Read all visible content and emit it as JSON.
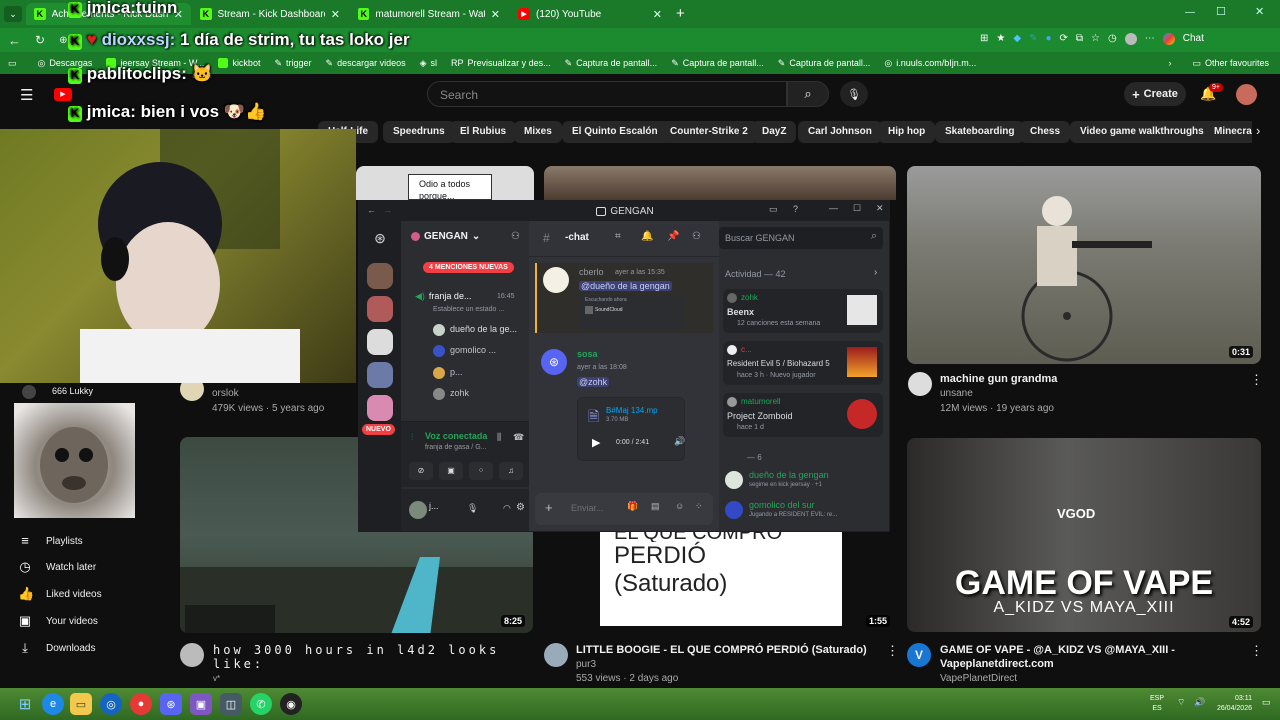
{
  "browser": {
    "tabs": [
      {
        "label": "Achievements - Kick Dashboard",
        "fav": "K"
      },
      {
        "label": "Stream - Kick Dashboard",
        "fav": "K"
      },
      {
        "label": "matumorell Stream - Watch Live o",
        "fav": "K"
      },
      {
        "label": "(120) YouTube",
        "fav": "▶"
      }
    ],
    "extension_label": "Chat",
    "bookmarks": [
      "Descargas",
      "jeersay Stream - W...",
      "kickbot",
      "trigger",
      "descargar videos",
      "sl",
      "Previsualizar y des...",
      "Captura de pantall...",
      "Captura de pantall...",
      "Captura de pantall...",
      "i.nuuls.com/bIjn.m..."
    ],
    "other_bookmarks": "Other favourites"
  },
  "overlay_chat": [
    {
      "user": "jmica:",
      "text": "tuinn"
    },
    {
      "user": "dioxxssj:",
      "text": "1 día de strim, tu tas loko jer"
    },
    {
      "user": "pablitoclips:",
      "text": ""
    },
    {
      "user": "jmica:",
      "text": "bien i vos"
    }
  ],
  "youtube": {
    "search_placeholder": "Search",
    "create_label": "Create",
    "notif_count": "9+",
    "chips": [
      "Half-Life",
      "Speedruns",
      "El Rubius",
      "Mixes",
      "El Quinto Escalón",
      "Counter-Strike 2",
      "DayZ",
      "Carl Johnson",
      "Hip hop",
      "Skateboarding",
      "Chess",
      "Video game walkthroughs",
      "Minecra"
    ],
    "sidebar": [
      {
        "label": "Playlists",
        "icon": "playlist-icon"
      },
      {
        "label": "Watch later",
        "icon": "clock-icon"
      },
      {
        "label": "Liked videos",
        "icon": "thumbs-up-icon"
      },
      {
        "label": "Your videos",
        "icon": "video-icon"
      },
      {
        "label": "Downloads",
        "icon": "download-icon"
      }
    ],
    "subscription_name": "666 Lukky",
    "videos": [
      {
        "title": "",
        "channel": "orslok",
        "meta": "479K views · 5 years ago",
        "duration": ""
      },
      {
        "title": "machine gun grandma",
        "channel": "unsane",
        "meta": "12M views · 19 years ago",
        "duration": "0:31"
      },
      {
        "title": "how 3000 hours in l4d2 looks like:",
        "channel": "v*",
        "meta": "",
        "duration": "8:25"
      },
      {
        "title": "LITTLE BOOGIE - EL QUE COMPRÓ PERDIÓ (Saturado)",
        "channel": "pur3",
        "meta": "553 views · 2 days ago",
        "duration": "1:55"
      },
      {
        "title": "GAME OF VAPE - @A_KIDZ VS @MAYA_XIII - Vapeplanetdirect.com",
        "channel": "VapePlanetDirect",
        "meta": "",
        "duration": "4:52"
      }
    ],
    "thumb_text_odio": "Odio a todos porque...",
    "thumb_text_perdio": "PERDIÓ",
    "thumb_text_saturado": "(Saturado)",
    "thumb_text_elque": "EL QUE COMPRÓ",
    "vape_line1": "GAME OF VAPE",
    "vape_line2": "A_KIDZ VS MAYA_XIII",
    "vape_logo": "VGOD"
  },
  "discord": {
    "title": "GENGAN",
    "server_name": "GENGAN",
    "mentions_badge": "4 MENCIONES NUEVAS",
    "channel_title": "-chat",
    "search_placeholder": "Buscar GENGAN",
    "voice_channel": "franja de...",
    "voice_time": "16:45",
    "voice_status": "Establece un estado ...",
    "voice_users": [
      "dueño de la ge...",
      "gomolico ...",
      "p...",
      "zohk"
    ],
    "nuevo": "NUEVO",
    "voice_connected": "Voz conectada",
    "voice_connected_sub": "franja de gasa / G...",
    "user_short": "j...",
    "messages": [
      {
        "user": "cberlo",
        "time": "ayer a las 15:35",
        "mention": "@dueño de la gengan",
        "embed_title": "SoundCloud",
        "embed_text": "Escuchando ahora"
      },
      {
        "user": "sosa",
        "time": "ayer a las 18:08",
        "mention": "@zohk",
        "file_name": "B#Maj 134.mp",
        "file_size": "3.70 MB",
        "audio_time": "0:00 / 2:41"
      }
    ],
    "input_placeholder": "Enviar...",
    "activity_title": "Actividad — 42",
    "activity": [
      {
        "user": "zohk",
        "title": "Beenx",
        "sub": "12 canciones esta semana"
      },
      {
        "user": "c...",
        "title": "Resident Evil 5 / Biohazard 5",
        "sub": "hace 3 h · Nuevo jugador"
      },
      {
        "user": "matumorell",
        "title": "Project Zomboid",
        "sub": "hace 1 d"
      }
    ],
    "group_label": "— 6",
    "members": [
      {
        "name": "dueño de la gengan",
        "status": "segime en kick jeersay · +1"
      },
      {
        "name": "gomolico del sur",
        "status": "Jugando a RESIDENT EVIL: re..."
      }
    ]
  },
  "taskbar": {
    "lang_line1": "ESP",
    "lang_line2": "ES",
    "time": "03:11",
    "date": "26/04/2026"
  }
}
